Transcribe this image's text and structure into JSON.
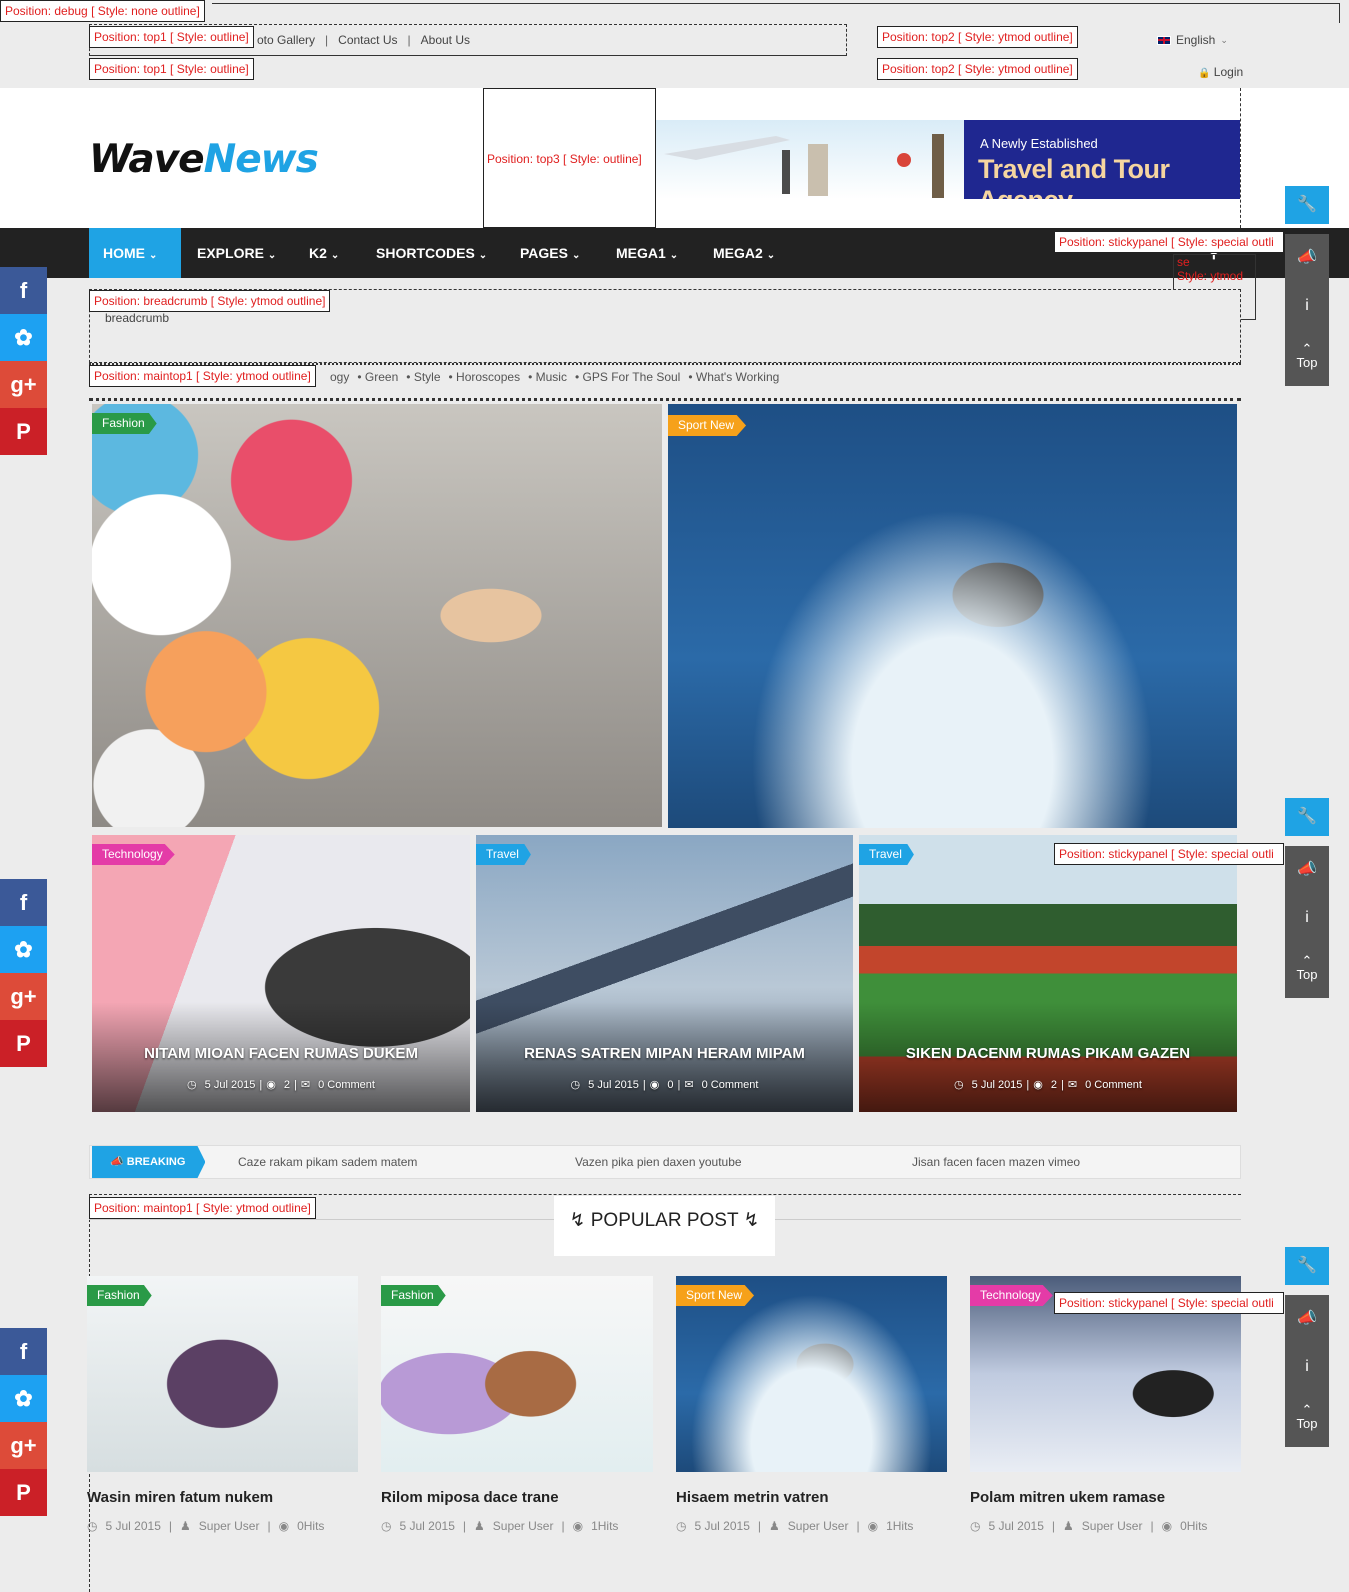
{
  "debug": {
    "top_label": "Position: debug [ Style: none outline]",
    "top1_label": "Position: top1 [ Style: outline]",
    "top2_label": "Position: top2 [ Style: ytmod outline]",
    "top3_label": "Position: top3 [ Style: outline]",
    "breadcrumb_label": "Position: breadcrumb [ Style: ytmod outline]",
    "maintop1_label": "Position: maintop1 [ Style: ytmod outline]",
    "stickypanel_label": "Position: stickypanel [ Style: special outli",
    "search_frag1": "se",
    "search_frag2": "Style: ytmod"
  },
  "top_links": [
    "oto Gallery",
    "Contact Us",
    "About Us"
  ],
  "language": "English",
  "login": "Login",
  "logo": {
    "part1": "Wave",
    "part2": "News"
  },
  "banner": {
    "line1": "A  Newly  Established",
    "line2": "Travel and Tour Agency"
  },
  "nav": [
    "HOME",
    "EXPLORE",
    "K2",
    "SHORTCODES",
    "PAGES",
    "MEGA1",
    "MEGA2"
  ],
  "breadcrumb_text": "breadcrumb",
  "tags": [
    "ogy",
    "Green",
    "Style",
    "Horoscopes",
    "Music",
    "GPS For The Soul",
    "What's Working"
  ],
  "featured": {
    "big": [
      {
        "category": "Fashion"
      },
      {
        "category": "Sport New"
      }
    ],
    "cards": [
      {
        "category": "Technology",
        "title": "NITAM MIOAN FACEN RUMAS DUKEM",
        "date": "5 Jul 2015",
        "views": "2",
        "comments": "0 Comment"
      },
      {
        "category": "Travel",
        "title": "RENAS SATREN MIPAN HERAM MIPAM",
        "date": "5 Jul 2015",
        "views": "0",
        "comments": "0 Comment"
      },
      {
        "category": "Travel",
        "title": "SIKEN DACENM RUMAS PIKAM GAZEN",
        "date": "5 Jul 2015",
        "views": "2",
        "comments": "0 Comment"
      }
    ]
  },
  "breaking": {
    "label": "BREAKING",
    "items": [
      "Caze rakam pikam sadem matem",
      "Vazen pika pien daxen youtube",
      "Jisan facen facen mazen vimeo"
    ]
  },
  "popular": {
    "heading": "POPULAR POST",
    "posts": [
      {
        "category": "Fashion",
        "title": "Wasin miren fatum nukem",
        "date": "5 Jul 2015",
        "author": "Super User",
        "hits": "0Hits"
      },
      {
        "category": "Fashion",
        "title": "Rilom miposa dace trane",
        "date": "5 Jul 2015",
        "author": "Super User",
        "hits": "1Hits"
      },
      {
        "category": "Sport New",
        "title": "Hisaem metrin vatren",
        "date": "5 Jul 2015",
        "author": "Super User",
        "hits": "1Hits"
      },
      {
        "category": "Technology",
        "title": "Polam mitren ukem ramase",
        "date": "5 Jul 2015",
        "author": "Super User",
        "hits": "0Hits"
      }
    ]
  },
  "sticky_top": "Top",
  "colors": {
    "accent": "#1fa3e4",
    "nav_bg": "#222222",
    "green": "#2a9a47",
    "orange": "#f6a11a",
    "pink": "#e43ba7"
  }
}
